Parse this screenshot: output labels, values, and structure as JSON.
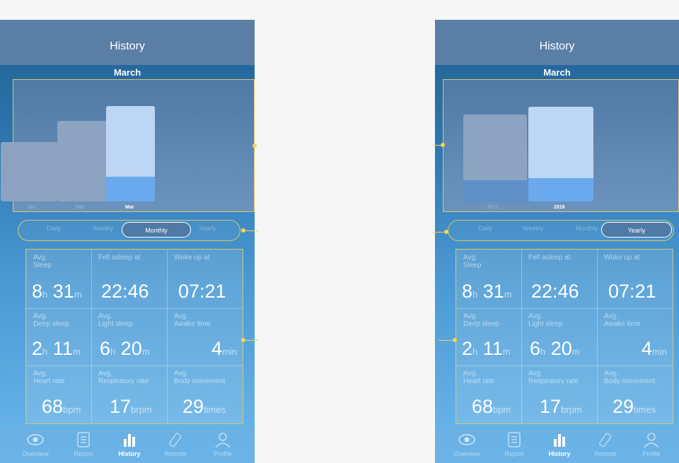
{
  "left": {
    "title": "History",
    "month": "March",
    "chart_labels": [
      "Jan",
      "Feb",
      "Mar"
    ],
    "tabs": [
      "Daily",
      "Weekly",
      "Monthly",
      "Yearly"
    ],
    "selected_tab": "Monthly"
  },
  "right": {
    "title": "History",
    "month": "March",
    "chart_labels": [
      "2017",
      "2018"
    ],
    "tabs": [
      "Daily",
      "Weekly",
      "Monthly",
      "Yearly"
    ],
    "selected_tab": "Yearly"
  },
  "stats": {
    "avg_sleep_label": "Avg.\nSleep",
    "avg_sleep_h": "8",
    "avg_sleep_h_unit": "h",
    "avg_sleep_m": "31",
    "avg_sleep_m_unit": "m",
    "fell_asleep_label": "Fell asleep at",
    "fell_asleep_value": "22:46",
    "woke_up_label": "Woke up at",
    "woke_up_value": "07:21",
    "deep_sleep_label": "Avg.\nDeep sleep",
    "deep_h": "2",
    "deep_h_unit": "h",
    "deep_m": "11",
    "deep_m_unit": "m",
    "light_sleep_label": "Avg.\nLight sleep",
    "light_h": "6",
    "light_h_unit": "h",
    "light_m": "20",
    "light_m_unit": "m",
    "awake_label": "Avg.\nAwake time",
    "awake_value": "4",
    "awake_unit": "min",
    "heart_label": "Avg.\nHeart rate",
    "heart_value": "68",
    "heart_unit": "bpm",
    "resp_label": "Avg.\nRespiratory rate",
    "resp_value": "17",
    "resp_unit": "brpm",
    "body_label": "Avg.\nBody movement",
    "body_value": "29",
    "body_unit": "times"
  },
  "tabbar": {
    "items": [
      {
        "label": "Overview",
        "icon": "eye-icon"
      },
      {
        "label": "Report",
        "icon": "report-icon"
      },
      {
        "label": "History",
        "icon": "bar-chart-icon"
      },
      {
        "label": "Remote",
        "icon": "remote-icon"
      },
      {
        "label": "Profile",
        "icon": "person-icon"
      }
    ],
    "active": "History"
  },
  "colors": {
    "accent_annotation": "#d8c56a",
    "header": "#5a7ea6",
    "bar_top_active": "#bdd6f3",
    "bar_bottom_active": "#6aa9ee",
    "bar_inactive": "#8da5c2"
  }
}
